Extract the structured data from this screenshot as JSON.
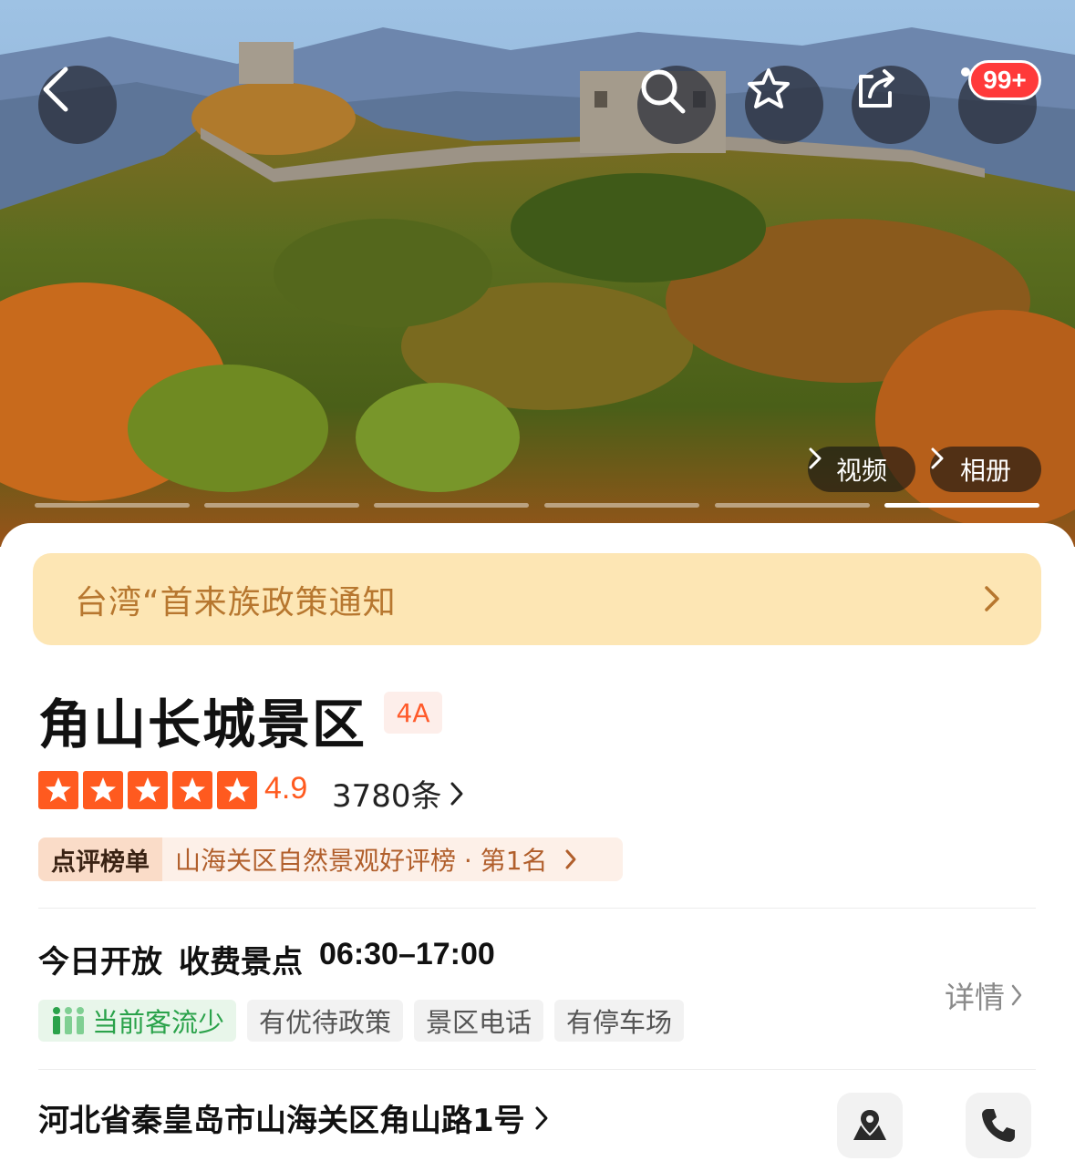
{
  "header": {
    "badge": "99+",
    "media_buttons": {
      "video": "视频",
      "album": "相册"
    },
    "gallery": {
      "total_slides": 6,
      "active_slide": 6
    }
  },
  "notice": {
    "text": "台湾“首来族政策通知"
  },
  "attraction": {
    "name": "角山长城景区",
    "level": "4A",
    "rating": "4.9",
    "stars": 5,
    "reviews": "3780条",
    "ranking": {
      "tag": "点评榜单",
      "text": "山海关区自然景观好评榜 · 第1名"
    }
  },
  "hours": {
    "status": "今日开放",
    "fee": "收费景点",
    "time": "06:30–17:00",
    "detail_link": "详情"
  },
  "tags": [
    "当前客流少",
    "有优待政策",
    "景区电话",
    "有停车场"
  ],
  "address": "河北省秦皇岛市山海关区角山路1号",
  "colors": {
    "accent": "#ff5a1f",
    "notice_bg": "#fde6b4",
    "notice_text": "#b7772f",
    "green": "#2aa24a"
  }
}
